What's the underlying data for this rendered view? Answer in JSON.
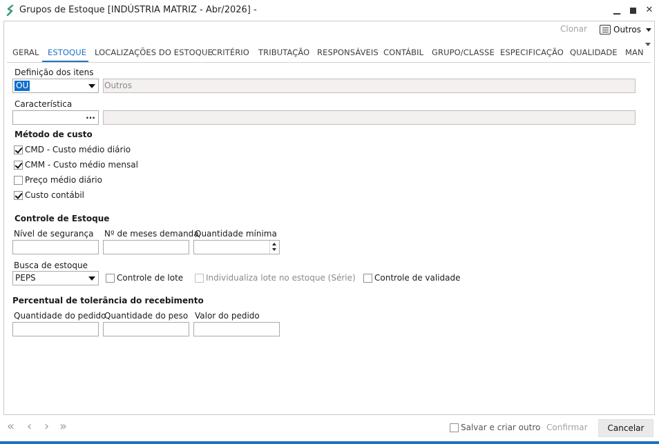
{
  "window": {
    "title": "Grupos de Estoque [INDÚSTRIA MATRIZ - Abr/2026]  -",
    "minimize_glyph": "▁",
    "close_glyph": "✕"
  },
  "toolbar": {
    "clonar": "Clonar",
    "outros": "Outros"
  },
  "tabs": [
    "GERAL",
    "ESTOQUE",
    "LOCALIZAÇÕES DO ESTOQUE",
    "CRITÉRIO",
    "TRIBUTAÇÃO",
    "RESPONSÁVEIS",
    "CONTÁBIL",
    "GRUPO/CLASSE",
    "ESPECIFICAÇÃO",
    "QUALIDADE",
    "MAN"
  ],
  "active_tab": "ESTOQUE",
  "form": {
    "definicao_label": "Definição dos itens",
    "definicao_value": "OU",
    "definicao_desc": "Outros",
    "caracteristica_label": "Característica",
    "caracteristica_button": "...",
    "metodo_label": "Método de custo",
    "metodo_items": [
      {
        "label": "CMD - Custo médio diário",
        "checked": true
      },
      {
        "label": "CMM - Custo médio mensal",
        "checked": true
      },
      {
        "label": "Preço médio diário",
        "checked": false
      },
      {
        "label": "Custo contábil",
        "checked": true
      }
    ],
    "controle_label": "Controle de Estoque",
    "nivel_label": "Nível de segurança",
    "meses_label": "Nº de meses demanda",
    "qtd_min_label": "Quantidade mínima",
    "busca_label": "Busca de estoque",
    "busca_value": "PEPS",
    "controle_lote": "Controle de lote",
    "individualiza": "Individualiza lote no estoque (Série)",
    "controle_validade": "Controle de validade",
    "percentual_label": "Percentual de tolerância do recebimento",
    "qtd_pedido_label": "Quantidade do pedido",
    "qtd_peso_label": "Quantidade do peso",
    "valor_pedido_label": "Valor do pedido"
  },
  "bottom": {
    "nav_first": "«",
    "nav_prev": "‹",
    "nav_next": "›",
    "nav_last": "»",
    "salvar_criar": "Salvar e criar outro",
    "confirmar": "Confirmar",
    "cancelar": "Cancelar"
  },
  "colors": {
    "accent": "#1e73be",
    "selection": "#0f6fcc",
    "app_icon": "#2e9b6e"
  }
}
